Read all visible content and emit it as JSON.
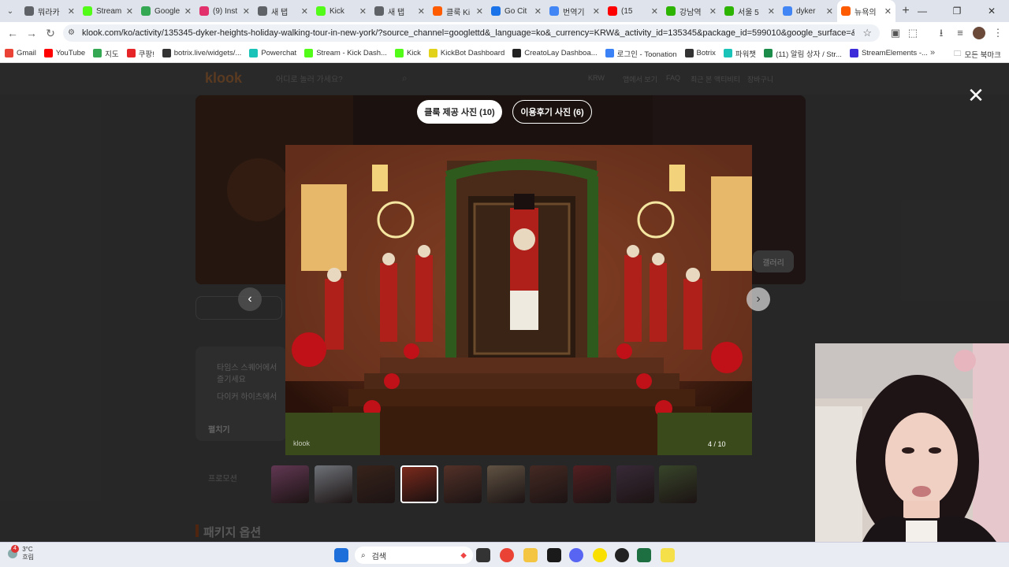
{
  "browser": {
    "tabs": [
      {
        "label": "뭐라카",
        "color": "#5f6368"
      },
      {
        "label": "Stream",
        "color": "#53fc18"
      },
      {
        "label": "Google",
        "color": "#34a853"
      },
      {
        "label": "(9) Inst",
        "color": "#e1306c"
      },
      {
        "label": "새 탭",
        "color": "#5f6368"
      },
      {
        "label": "Kick",
        "color": "#53fc18"
      },
      {
        "label": "새 탭",
        "color": "#5f6368"
      },
      {
        "label": "클룩 Ki",
        "color": "#ff5b00"
      },
      {
        "label": "Go Cit",
        "color": "#1a73e8"
      },
      {
        "label": "번역기",
        "color": "#4285f4"
      },
      {
        "label": "(15",
        "color": "#ff0000"
      },
      {
        "label": "강남역",
        "color": "#2db400"
      },
      {
        "label": "서울 5",
        "color": "#2db400"
      },
      {
        "label": "dyker",
        "color": "#4285f4"
      },
      {
        "label": "뉴욕의",
        "color": "#ff5b00"
      }
    ],
    "url": "klook.com/ko/activity/135345-dyker-heights-holiday-walking-tour-in-new-york/?source_channel=googlettd&_language=ko&_currency=KRW&_activity_id=135345&package_id=599010&google_surface=&google_ads_click_source=t...",
    "bookmarks": [
      {
        "label": "Gmail",
        "color": "#ea4335"
      },
      {
        "label": "YouTube",
        "color": "#ff0000"
      },
      {
        "label": "지도",
        "color": "#34a853"
      },
      {
        "label": "쿠팡!",
        "color": "#e52528"
      },
      {
        "label": "botrix.live/widgets/...",
        "color": "#333333"
      },
      {
        "label": "Powerchat",
        "color": "#19c3b8"
      },
      {
        "label": "Stream - Kick Dash...",
        "color": "#53fc18"
      },
      {
        "label": "Kick",
        "color": "#53fc18"
      },
      {
        "label": "KickBot Dashboard",
        "color": "#e3d21a"
      },
      {
        "label": "CreatoLay Dashboa...",
        "color": "#222222"
      },
      {
        "label": "로그인 - Toonation",
        "color": "#3b82f6"
      },
      {
        "label": "Botrix",
        "color": "#333333"
      },
      {
        "label": "파워챗",
        "color": "#19c3b8"
      },
      {
        "label": "(11) 알림 상자 / Str...",
        "color": "#1c8c4a"
      },
      {
        "label": "StreamElements -...",
        "color": "#3b2bd9"
      }
    ],
    "all_bookmarks": "모든 북마크"
  },
  "page": {
    "logo": "klook",
    "search_placeholder": "어디로 놀러 가세요?",
    "nav": [
      "KRW",
      "앱에서 보기",
      "FAQ",
      "최근 본 액티비티",
      "장바구니"
    ],
    "gallery_btn": "갤러리",
    "bullets": [
      "타임스 스퀘어에서",
      "즐기세요",
      "다이커 하이츠에서"
    ],
    "more": "펼치기",
    "promo": "프로모션",
    "package_title": "패키지 옵션"
  },
  "gallery": {
    "tab_klook": "클룩 제공 사진 (10)",
    "tab_review": "이용후기 사진 (6)",
    "counter": "4 / 10",
    "watermark": "klook",
    "selected_index": 3,
    "thumbs": [
      "#6b3a5a",
      "#7a7f86",
      "#3a2218",
      "#7a2a1c",
      "#5a3328",
      "#6a5a48",
      "#4a2a22",
      "#5a1e20",
      "#3a2a3a",
      "#3a4a2a"
    ]
  },
  "taskbar": {
    "weather_temp": "3°C",
    "weather_desc": "흐림",
    "search_label": "검색",
    "notif": "4"
  }
}
